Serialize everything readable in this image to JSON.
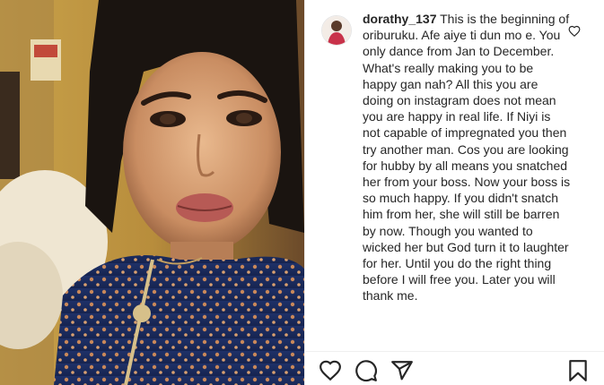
{
  "post": {
    "username": "dorathy_137",
    "caption_text": "This is the beginning of oriburuku. Afe aiye ti dun mo e. You only dance from Jan to December. What's really making you to be happy gan nah? All this you are doing on instagram does not mean you are happy in real life. If Niyi is not capable of impregnated you then try another man. Cos you are looking for hubby by all means you snatched her from your boss. Now your boss is so much happy. If you didn't snatch him from her, she will still be barren by now. Though you wanted to wicked her but God turn it to laughter for her. Until you do the right thing before I will free you. Later you will thank me."
  },
  "icons": {
    "like": "heart-icon",
    "comment": "comment-icon",
    "share": "share-icon",
    "save": "bookmark-icon",
    "caption_like": "heart-outline-icon"
  },
  "colors": {
    "text": "#262626",
    "divider": "#efefef",
    "icon": "#262626"
  }
}
